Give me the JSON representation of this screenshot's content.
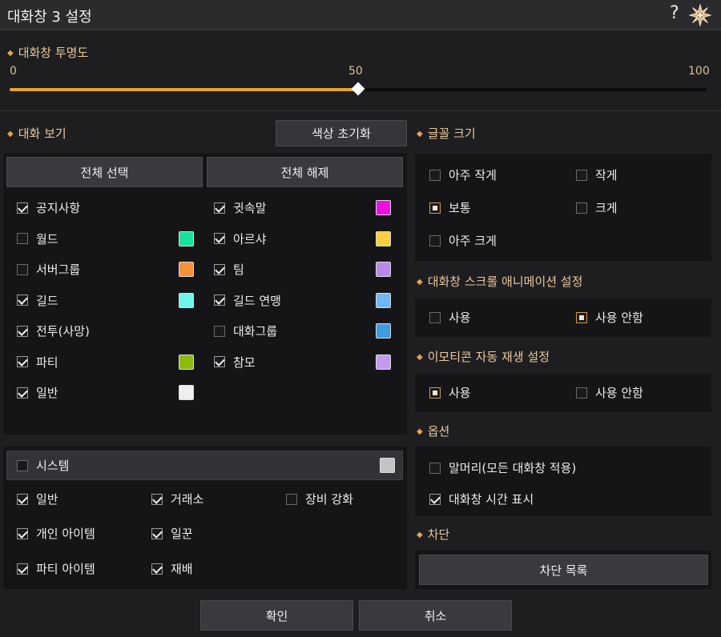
{
  "window": {
    "title": "대화창 3 설정",
    "help_glyph": "?",
    "close_icon": "close-icon"
  },
  "opacity": {
    "title": "대화창 투명도",
    "min_label": "0",
    "value_label": "50",
    "max_label": "100",
    "value": 50,
    "max": 100,
    "accent": "#e8a434"
  },
  "chat_view": {
    "title": "대화 보기",
    "reset_color_label": "색상 초기화",
    "select_all_label": "전체 선택",
    "deselect_all_label": "전체 해제",
    "left": [
      {
        "label": "공지사항",
        "checked": true,
        "color": null
      },
      {
        "label": "월드",
        "checked": false,
        "color": "#19e09a"
      },
      {
        "label": "서버그룹",
        "checked": false,
        "color": "#f5913a"
      },
      {
        "label": "길드",
        "checked": true,
        "color": "#6ff5ec"
      },
      {
        "label": "전투(사망)",
        "checked": true,
        "color": null
      },
      {
        "label": "파티",
        "checked": true,
        "color": "#8cba0f"
      },
      {
        "label": "일반",
        "checked": true,
        "color": "#eeeeee"
      }
    ],
    "right": [
      {
        "label": "귓속말",
        "checked": true,
        "color": "#ee10e3"
      },
      {
        "label": "아르샤",
        "checked": true,
        "color": "#f8cf3c"
      },
      {
        "label": "팀",
        "checked": true,
        "color": "#b88ae8"
      },
      {
        "label": "길드 연맹",
        "checked": true,
        "color": "#70b8f5"
      },
      {
        "label": "대화그룹",
        "checked": false,
        "color": "#3f9ae0"
      },
      {
        "label": "참모",
        "checked": true,
        "color": "#c39af0"
      }
    ]
  },
  "system": {
    "label": "시스템",
    "checked": false,
    "color": "#c4c4c4",
    "items": [
      {
        "label": "일반",
        "checked": true
      },
      {
        "label": "거래소",
        "checked": true
      },
      {
        "label": "장비 강화",
        "checked": false
      },
      {
        "label": "개인 아이템",
        "checked": true
      },
      {
        "label": "일꾼",
        "checked": true
      },
      {
        "label": "파티 아이템",
        "checked": true
      },
      {
        "label": "재배",
        "checked": true
      }
    ]
  },
  "font_size": {
    "title": "글꼴 크기",
    "options": [
      {
        "label": "아주 작게",
        "selected": false
      },
      {
        "label": "작게",
        "selected": false
      },
      {
        "label": "보통",
        "selected": true
      },
      {
        "label": "크게",
        "selected": false
      },
      {
        "label": "아주 크게",
        "selected": false
      }
    ]
  },
  "scroll_anim": {
    "title": "대화창 스크롤 애니메이션 설정",
    "options": [
      {
        "label": "사용",
        "selected": false
      },
      {
        "label": "사용 안함",
        "selected": true
      }
    ]
  },
  "emoticon": {
    "title": "이모티콘 자동 재생 설정",
    "options": [
      {
        "label": "사용",
        "selected": true
      },
      {
        "label": "사용 안함",
        "selected": false
      }
    ]
  },
  "options": {
    "title": "옵션",
    "items": [
      {
        "label": "말머리(모든 대화창 적용)",
        "checked": false
      },
      {
        "label": "대화창 시간 표시",
        "checked": true
      }
    ]
  },
  "block": {
    "title": "차단",
    "list_label": "차단 목록"
  },
  "footer": {
    "confirm_label": "확인",
    "cancel_label": "취소"
  }
}
